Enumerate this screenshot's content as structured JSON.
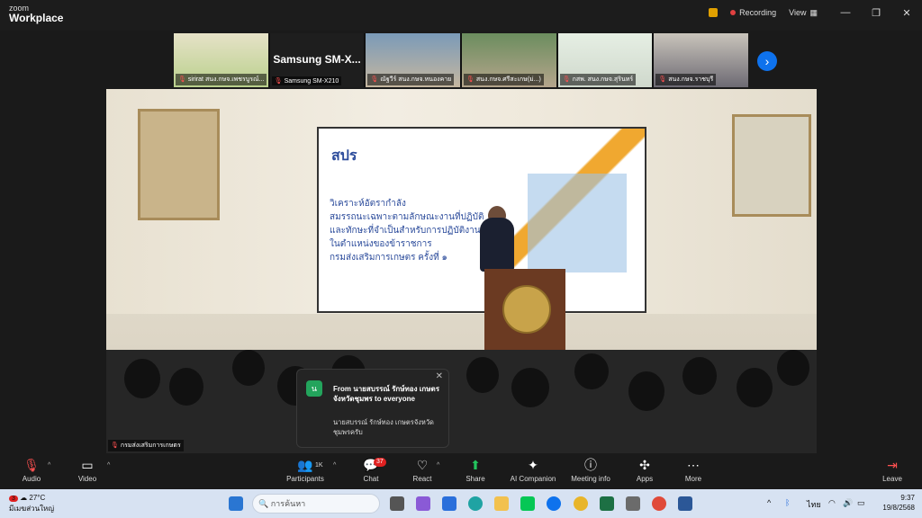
{
  "app": {
    "brand_line1": "zoom",
    "brand_line2": "Workplace"
  },
  "titlebar": {
    "recording_label": "Recording",
    "view_label": "View"
  },
  "participants_strip": [
    {
      "name": "sirirat สนง.กษจ.เพชรบูรณ์..."
    },
    {
      "name": "Samsung SM-X210",
      "big_label": "Samsung SM-X..."
    },
    {
      "name": "ณัฐวีร์ สนง.กษจ.หนองคาย"
    },
    {
      "name": "สนง.กษจ.ศรีสะเกษ(ม่...)"
    },
    {
      "name": "กสพ. สนง.กษจ.สุรินทร์"
    },
    {
      "name": "สนง.กษจ.ราชบุรี"
    }
  ],
  "main_video": {
    "name": "กรมส่งเสริมการเกษตร",
    "slide_title": "สปร",
    "slide_text": [
      "วิเคราะห์อัตรากำลัง",
      "สมรรถนะเฉพาะตามลักษณะงานที่ปฏิบัติ",
      "และทักษะที่จำเป็นสำหรับการปฏิบัติงาน",
      "ในตำแหน่งของข้าราชการ",
      "กรมส่งเสริมการเกษตร ครั้งที่ ๑"
    ]
  },
  "chat_popup": {
    "avatar_text": "น",
    "header": "From นายสบรรณ์ รักษ์ทอง เกษตรจังหวัดชุมพร to everyone",
    "message": "นายสบรรณ์ รักษ์ทอง เกษตรจังหวัดชุมพรครับ"
  },
  "toolbar": {
    "audio": "Audio",
    "video": "Video",
    "participants": "Participants",
    "participants_count": "1K",
    "chat": "Chat",
    "chat_badge": "37",
    "react": "React",
    "share": "Share",
    "ai_companion": "AI Companion",
    "meeting_info": "Meeting info",
    "apps": "Apps",
    "more": "More",
    "leave": "Leave"
  },
  "taskbar": {
    "weather_badge": "3",
    "temperature": "27°C",
    "weather_desc": "มีเมฆส่วนใหญ่",
    "search_placeholder": "การค้นหา",
    "language": "ไทย",
    "time": "9:37",
    "date": "19/8/2568"
  },
  "colors": {
    "accent": "#0e72ed",
    "danger": "#e02020",
    "share": "#23c55e"
  }
}
